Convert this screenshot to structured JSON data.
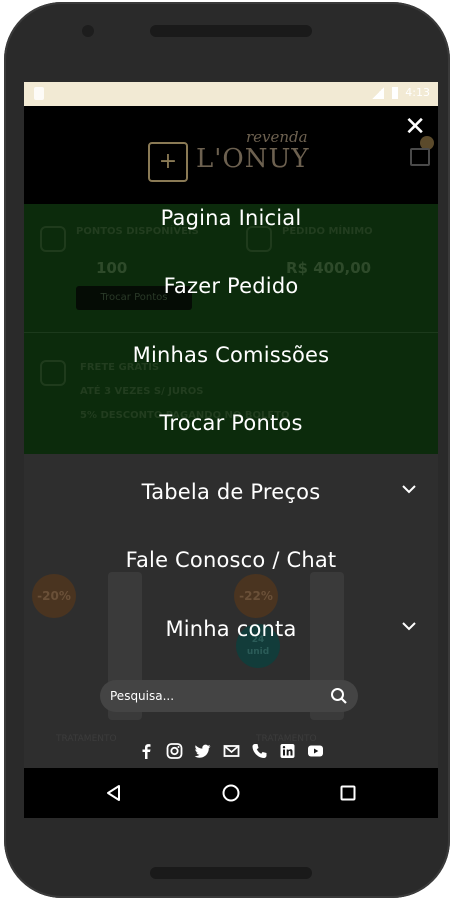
{
  "status_bar": {
    "time": "4:13"
  },
  "header": {
    "logo_sub": "revenda",
    "logo_main": "L'ONUY"
  },
  "background_page": {
    "points_label": "PONTOS DISPONÍVEIS",
    "points_value": "100",
    "exchange_button": "Trocar Pontos",
    "min_order_label": "PEDIDO MÍNIMO",
    "min_order_value": "R$ 400,00",
    "shipping_title": "FRETE GRÁTIS",
    "installments": "ATÉ 3 VEZES S/ JUROS",
    "discount": "5% DESCONTO PAGANDO NO BOLETO",
    "badge1": "-20%",
    "badge2": "-22%",
    "stock_badge_qty": "24",
    "stock_badge_unit": "unid",
    "product1_category": "TRATAMENTO",
    "product2_category": "TRATAMENTO"
  },
  "menu": {
    "items": [
      {
        "label": "Pagina Inicial",
        "has_chevron": false
      },
      {
        "label": "Fazer Pedido",
        "has_chevron": false
      },
      {
        "label": "Minhas Comissões",
        "has_chevron": false
      },
      {
        "label": "Trocar Pontos",
        "has_chevron": false
      },
      {
        "label": "Tabela de Preços",
        "has_chevron": true
      },
      {
        "label": "Fale Conosco / Chat",
        "has_chevron": false
      },
      {
        "label": "Minha conta",
        "has_chevron": true
      }
    ],
    "close_label": "✕"
  },
  "search": {
    "placeholder": "Pesquisa..."
  },
  "social_icons": [
    "facebook-icon",
    "instagram-icon",
    "twitter-icon",
    "email-icon",
    "phone-icon",
    "linkedin-icon",
    "youtube-icon"
  ],
  "colors": {
    "overlay_bg": "#1b1b1b",
    "menu_text": "#ffffff",
    "status_bar": "#f2ead4",
    "green_panel": "#0c2b0c"
  }
}
